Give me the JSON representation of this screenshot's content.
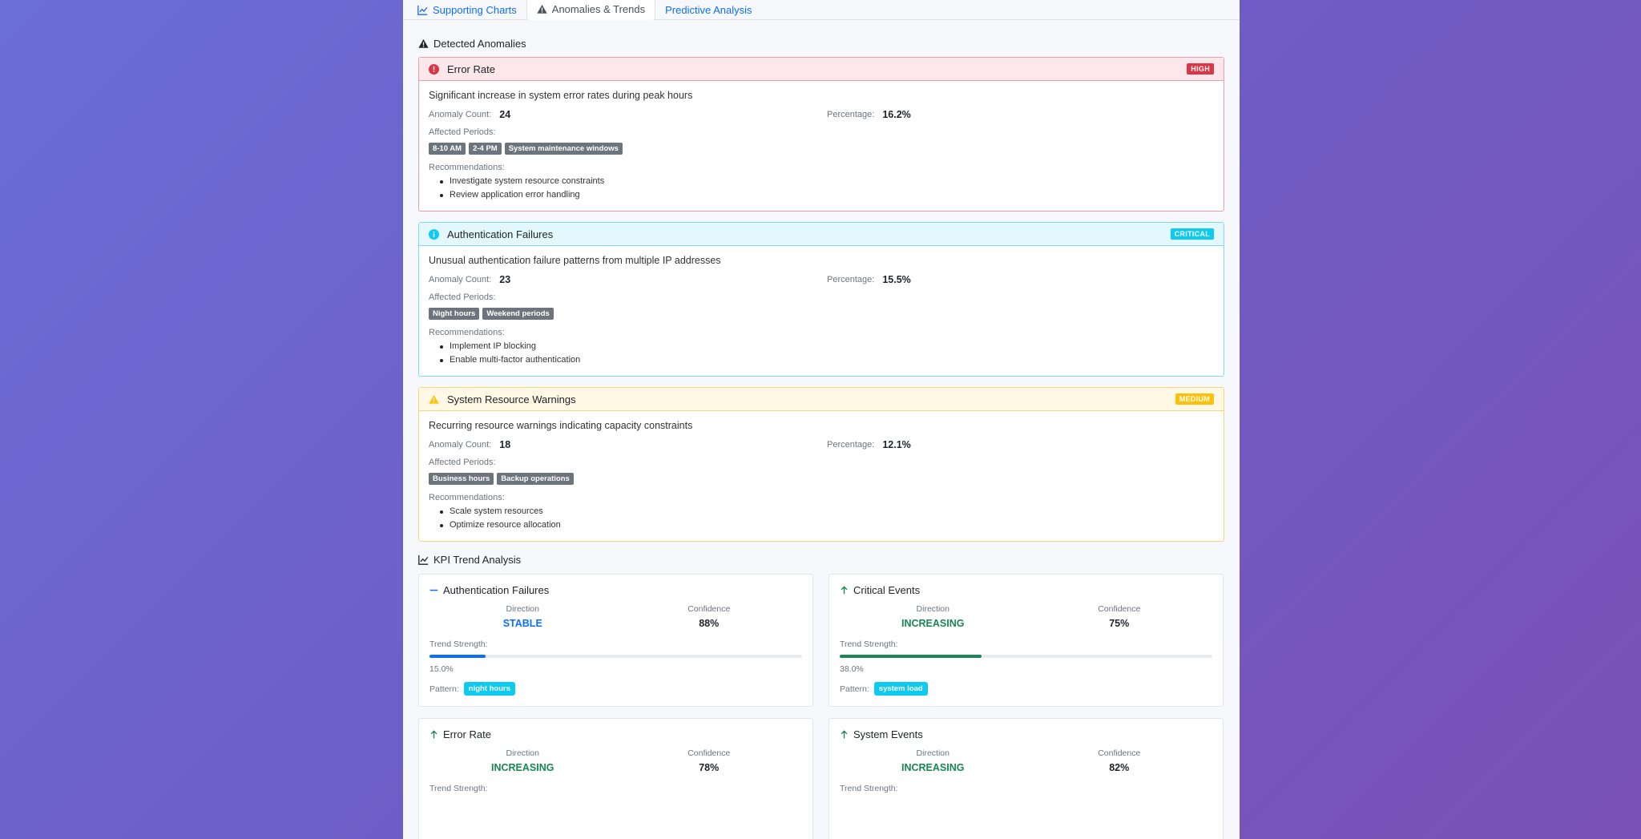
{
  "colors": {
    "primary": "#0d6efd",
    "danger": "#dc3545",
    "info": "#0dcaf0",
    "warning": "#ffc107",
    "success": "#198754",
    "stable": "#0d6efd",
    "increasing": "#198754"
  },
  "tabs": [
    {
      "label": "Supporting Charts",
      "icon": "chart-line-icon",
      "active": false
    },
    {
      "label": "Anomalies & Trends",
      "icon": "warning-triangle-icon",
      "active": true
    },
    {
      "label": "Predictive Analysis",
      "icon": "",
      "active": false
    }
  ],
  "anomalies_section": {
    "title": "Detected Anomalies",
    "icon": "warning-triangle-icon",
    "count_label": "Anomaly Count:",
    "percentage_label": "Percentage:",
    "periods_label": "Affected Periods:",
    "recs_label": "Recommendations:",
    "items": [
      {
        "name": "Error Rate",
        "icon": "exclamation-circle-icon",
        "severity": "HIGH",
        "severity_color": "#dc3545",
        "border_color": "#e8a0a8",
        "head_bg": "#fde7ea",
        "description": "Significant increase in system error rates during peak hours",
        "count": "24",
        "percentage": "16.2%",
        "periods": [
          "8-10 AM",
          "2-4 PM",
          "System maintenance windows"
        ],
        "recommendations": [
          "Investigate system resource constraints",
          "Review application error handling"
        ]
      },
      {
        "name": "Authentication Failures",
        "icon": "info-circle-icon",
        "severity": "CRITICAL",
        "severity_color": "#0dcaf0",
        "border_color": "#7fdcef",
        "head_bg": "#e3f8fd",
        "description": "Unusual authentication failure patterns from multiple IP addresses",
        "count": "23",
        "percentage": "15.5%",
        "periods": [
          "Night hours",
          "Weekend periods"
        ],
        "recommendations": [
          "Implement IP blocking",
          "Enable multi-factor authentication"
        ]
      },
      {
        "name": "System Resource Warnings",
        "icon": "warning-triangle-icon",
        "severity": "MEDIUM",
        "severity_color": "#ffc107",
        "border_color": "#f5d67a",
        "head_bg": "#fef8e4",
        "description": "Recurring resource warnings indicating capacity constraints",
        "count": "18",
        "percentage": "12.1%",
        "periods": [
          "Business hours",
          "Backup operations"
        ],
        "recommendations": [
          "Scale system resources",
          "Optimize resource allocation"
        ]
      }
    ]
  },
  "kpi_section": {
    "title": "KPI Trend Analysis",
    "icon": "chart-line-icon",
    "direction_label": "Direction",
    "confidence_label": "Confidence",
    "strength_label": "Trend Strength:",
    "pattern_label": "Pattern:",
    "items": [
      {
        "name": "Authentication Failures",
        "icon": "dash-icon",
        "direction": "STABLE",
        "direction_color": "#0d6efd",
        "confidence": "88%",
        "strength": 0.15,
        "strength_text": "15.0%",
        "bar_color": "#0d6efd",
        "pattern": "night hours",
        "pattern_color": "#0dcaf0"
      },
      {
        "name": "Critical Events",
        "icon": "arrow-up-icon",
        "direction": "INCREASING",
        "direction_color": "#198754",
        "confidence": "75%",
        "strength": 0.38,
        "strength_text": "38.0%",
        "bar_color": "#198754",
        "pattern": "system load",
        "pattern_color": "#0dcaf0"
      },
      {
        "name": "Error Rate",
        "icon": "arrow-up-icon",
        "direction": "INCREASING",
        "direction_color": "#198754",
        "confidence": "78%",
        "strength": null,
        "strength_text": "",
        "bar_color": "#198754",
        "pattern": "",
        "pattern_color": "#0dcaf0"
      },
      {
        "name": "System Events",
        "icon": "arrow-up-icon",
        "direction": "INCREASING",
        "direction_color": "#198754",
        "confidence": "82%",
        "strength": null,
        "strength_text": "",
        "bar_color": "#198754",
        "pattern": "",
        "pattern_color": "#0dcaf0"
      }
    ]
  }
}
